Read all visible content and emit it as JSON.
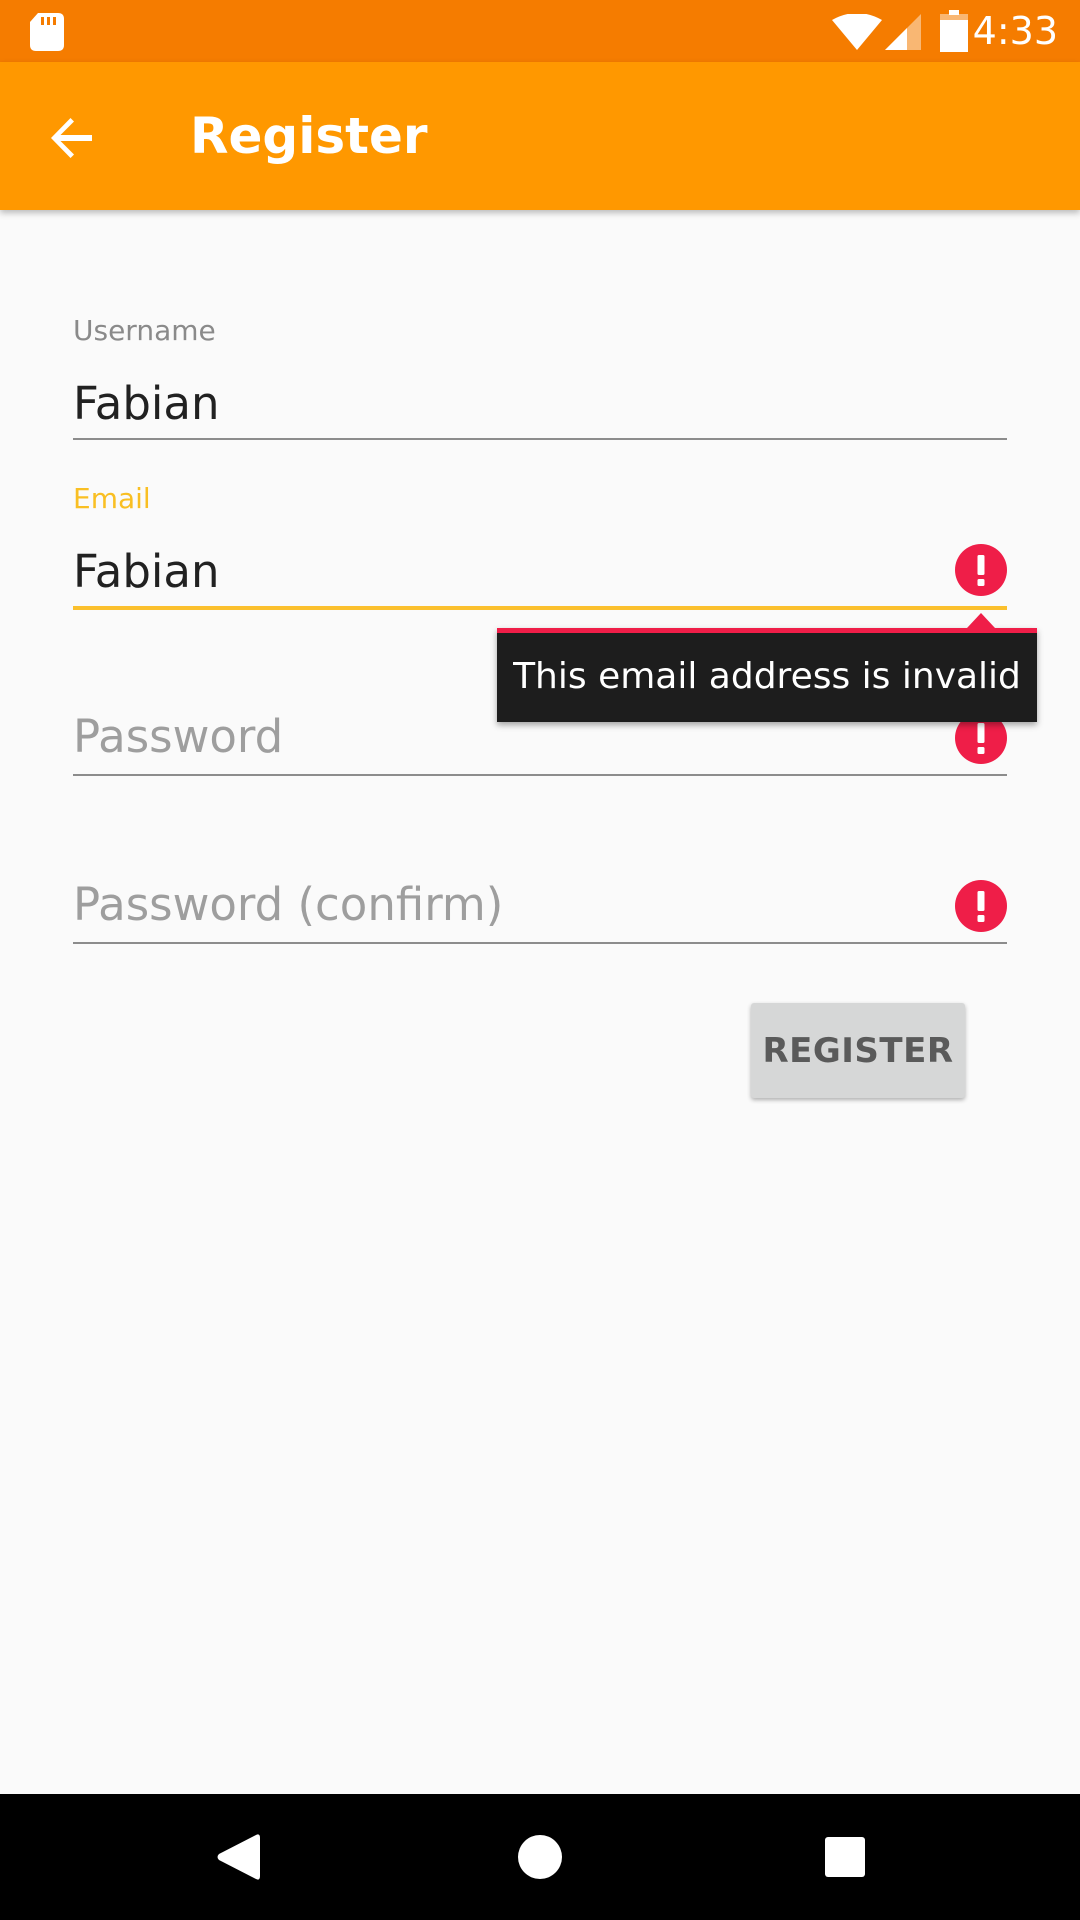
{
  "status_bar": {
    "time": "4:33",
    "icons": [
      "sd-card-icon",
      "wifi-icon",
      "cell-signal-icon",
      "battery-icon"
    ]
  },
  "app_bar": {
    "title": "Register",
    "back_icon": "arrow-back-icon",
    "background_color": "#ff9800"
  },
  "form": {
    "username": {
      "label": "Username",
      "value": "Fabian"
    },
    "email": {
      "label": "Email",
      "value": "Fabian",
      "error": "This email address is invalid",
      "focused_color": "#fbc02d"
    },
    "password": {
      "placeholder": "Password"
    },
    "password_confirm": {
      "placeholder": "Password (confirm)"
    },
    "error_icon": "error-alert-icon",
    "error_color": "#ef1e48",
    "register_label": "REGISTER"
  },
  "nav_bar": {
    "icons": [
      "back-triangle-icon",
      "home-circle-icon",
      "recents-square-icon"
    ]
  }
}
